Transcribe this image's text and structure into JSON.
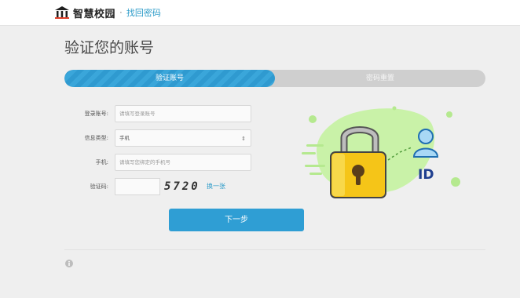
{
  "header": {
    "brand": "智慧校园",
    "separator": "·",
    "breadcrumb": "找回密码"
  },
  "page": {
    "title": "验证您的账号"
  },
  "steps": [
    {
      "label": "验证账号",
      "active": true
    },
    {
      "label": "密码重置",
      "active": false
    }
  ],
  "form": {
    "account": {
      "label": "登录账号:",
      "placeholder": "请填写登录账号"
    },
    "info_type": {
      "label": "信息类型:",
      "value": "手机"
    },
    "phone": {
      "label": "手机:",
      "placeholder": "请填写您绑定的手机号"
    },
    "captcha": {
      "label": "验证码:",
      "code": "5720",
      "refresh": "换一张"
    }
  },
  "actions": {
    "next": "下一步"
  },
  "illustration": {
    "badge_text": "ID"
  },
  "colors": {
    "accent": "#2f9ed4",
    "lock": "#f5c518",
    "leaf": "#c9f2a8"
  }
}
